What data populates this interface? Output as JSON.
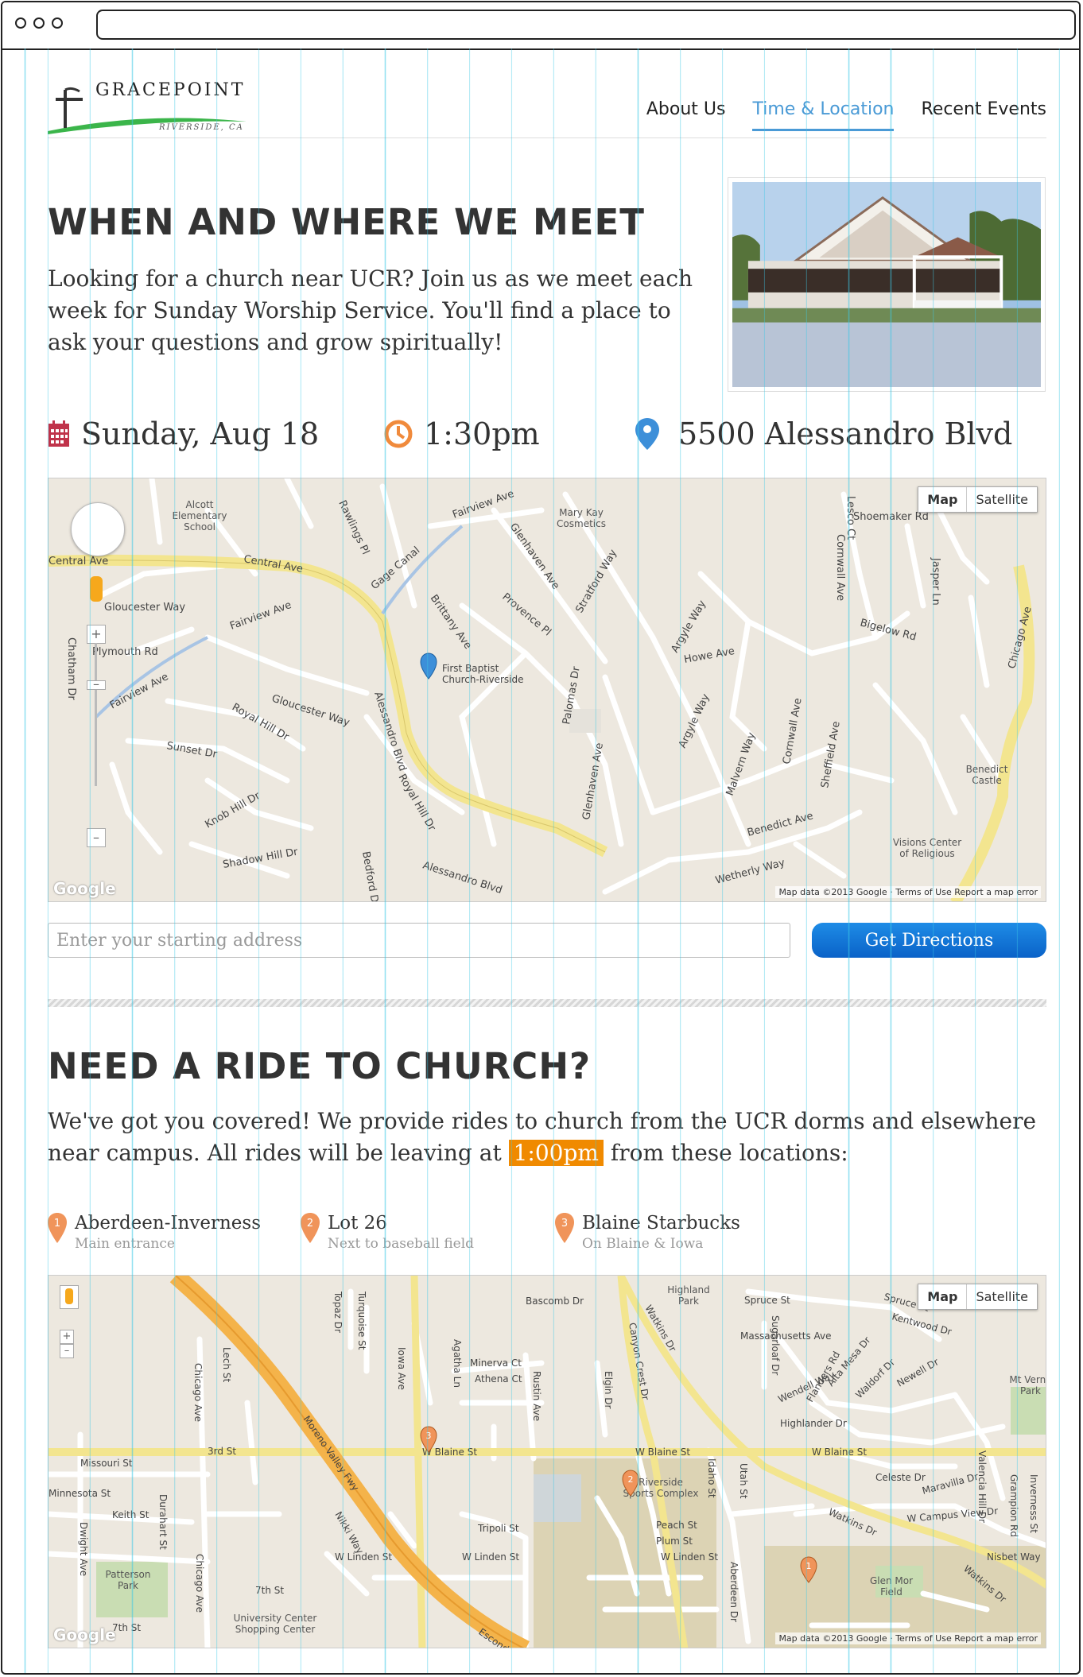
{
  "nav": {
    "logo_text": "GRACEPOINT",
    "logo_sub": "RIVERSIDE, CA",
    "items": [
      {
        "label": "About Us",
        "active": false
      },
      {
        "label": "Time & Location",
        "active": true
      },
      {
        "label": "Recent Events",
        "active": false
      }
    ]
  },
  "meet": {
    "title": "WHEN AND WHERE WE MEET",
    "intro": "Looking for a church near UCR? Join us as we meet each week for Sunday Worship Service. You'll find a place to ask your questions and grow spiritually!",
    "date": "Sunday, Aug 18",
    "time": "1:30pm",
    "address": "5500 Alessandro Blvd"
  },
  "map1": {
    "type_map": "Map",
    "type_satellite": "Satellite",
    "attribution": "Map data ©2013 Google · Terms of Use   Report a map error",
    "google": "Google",
    "marker_label": "First Baptist Church-Riverside",
    "streets": [
      "Central Ave",
      "Fairview Ave",
      "Gloucester Way",
      "Plymouth Rd",
      "Royal Hill Dr",
      "Sunset Dr",
      "Knob Hill Dr",
      "Shadow Hill Dr",
      "Alessandro Blvd",
      "Brittany Ave",
      "Provence Pl",
      "Glenhaven Ave",
      "Stratford Way",
      "Argyle Way",
      "Howe Ave",
      "Malvern Way",
      "Cornwall Ave",
      "Sheffield Ave",
      "Benedict Ave",
      "Wetherly Way",
      "Bigelow Rd",
      "Shoemaker Rd",
      "Jasper Ln",
      "Chicago Ave",
      "Chatham Dr",
      "Gage Canal",
      "Rawlings Pl",
      "Palomas Dr",
      "Bedford Dr",
      "Lesco Ct"
    ],
    "places": [
      "Alcott Elementary School",
      "Mary Kay Cosmetics",
      "Benedict Castle",
      "Visions Center of Religious"
    ]
  },
  "directions": {
    "placeholder": "Enter your starting address",
    "button": "Get Directions"
  },
  "ride": {
    "title": "NEED A RIDE TO CHURCH?",
    "text_before": "We've got you covered! We provide rides to church from the UCR dorms and elsewhere near campus. All rides will be leaving at ",
    "time": "1:00pm",
    "text_after": " from these locations:",
    "locations": [
      {
        "num": "1",
        "name": "Aberdeen-Inverness",
        "sub": "Main entrance"
      },
      {
        "num": "2",
        "name": "Lot 26",
        "sub": "Next to baseball field"
      },
      {
        "num": "3",
        "name": "Blaine Starbucks",
        "sub": "On Blaine & Iowa"
      }
    ]
  },
  "map2": {
    "type_map": "Map",
    "type_satellite": "Satellite",
    "attribution": "Map data ©2013 Google · Terms of Use   Report a map error",
    "google": "Google",
    "streets": [
      "3rd St",
      "W Blaine St",
      "W Linden St",
      "Iowa Ave",
      "Chicago Ave",
      "Canyon Crest Dr",
      "Watkins Dr",
      "Moreno Valley Fwy",
      "Spruce St",
      "Massachusetts Ave",
      "Highlander Dr",
      "Missouri St",
      "Minnesota St",
      "Keith St",
      "7th St",
      "Bascomb Dr",
      "Minerva Ct",
      "Athena Ct",
      "Rustin Ave",
      "Tripoli St",
      "Peach St",
      "Plum St",
      "Aberdeen Dr",
      "Utah St",
      "Idaho St",
      "Valencia Hill Dr",
      "Nisbet Way",
      "Celeste Dr",
      "Maravilla Dr",
      "Kentwood Dr",
      "Newell Dr",
      "Waldorf Dr",
      "Flanders Rd",
      "Wendell Way",
      "Alta Mesa Dr",
      "Sugarloaf Dr",
      "Durahart St",
      "Lech St",
      "Topaz Dr",
      "Turquoise St",
      "Agatha Ln",
      "Elgin Dr",
      "Dwight Ave",
      "Nikki Way",
      "Escondido"
    ],
    "places": [
      "Highland Park",
      "Patterson Park",
      "University Center Shopping Center",
      "Riverside Sports Complex",
      "Glen Mor Field",
      "Mt Vernon Park"
    ]
  },
  "colors": {
    "accent": "#4a9ad6",
    "calendar": "#c0334a",
    "clock": "#f08a3c",
    "pin": "#3d8fd9",
    "orange": "#f08a00",
    "button": "#0a62c8"
  }
}
